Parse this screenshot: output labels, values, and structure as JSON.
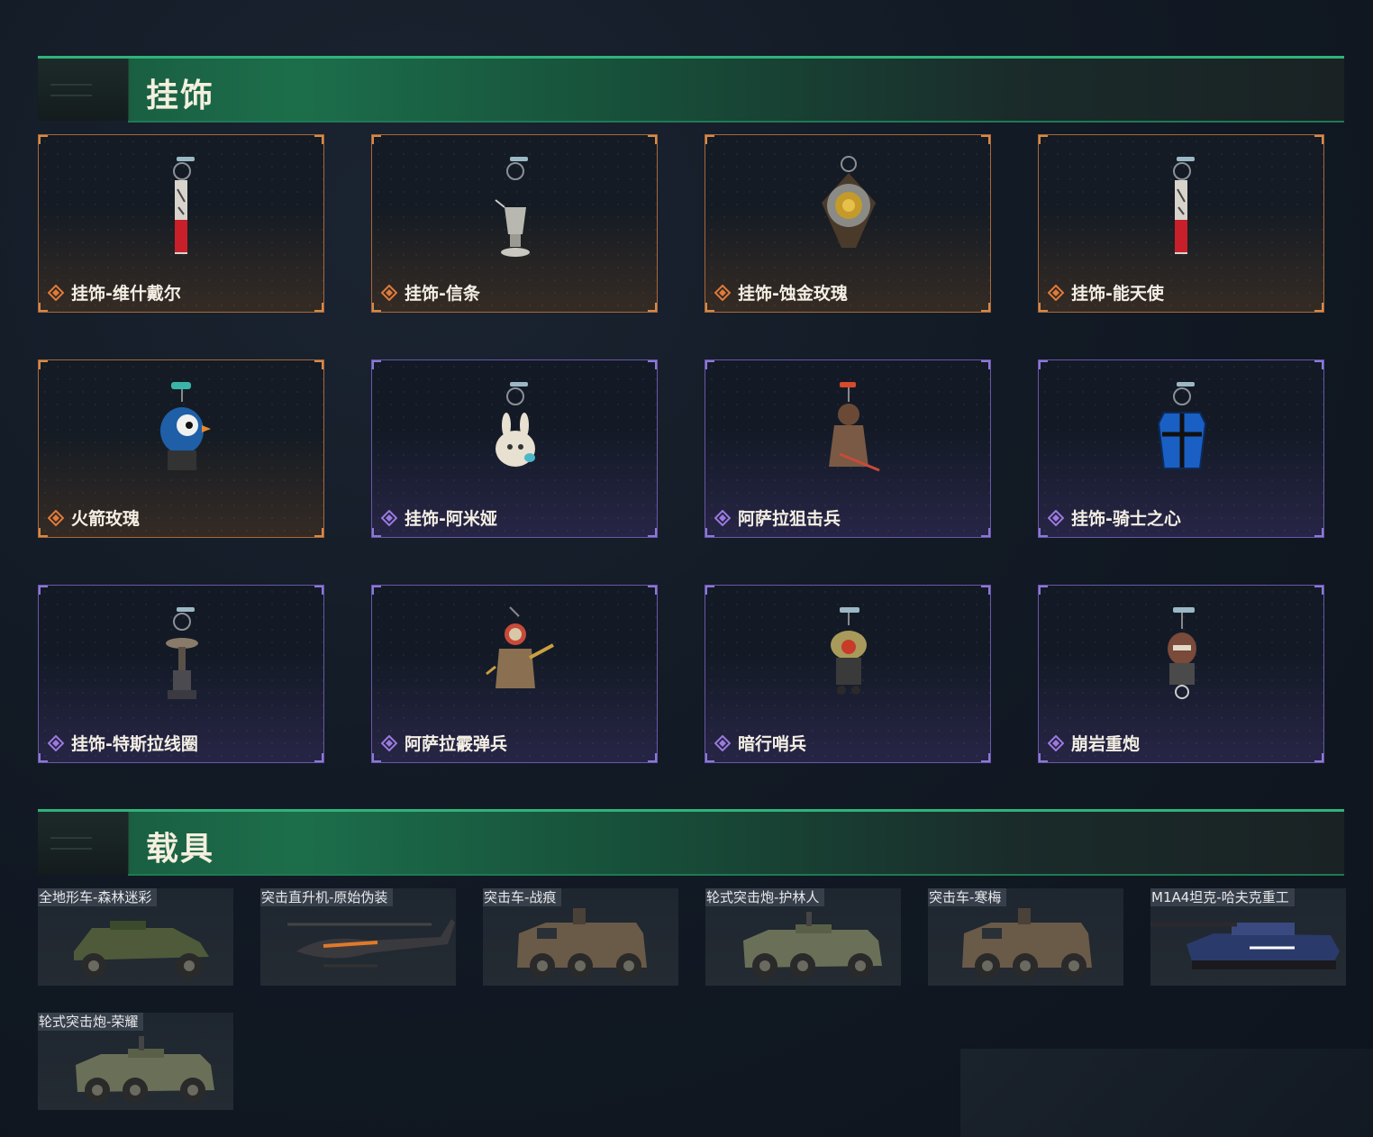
{
  "sections": {
    "charms": {
      "title": "挂饰"
    },
    "vehicles": {
      "title": "载具"
    }
  },
  "charms": [
    {
      "name": "挂饰-维什戴尔",
      "rarity": "gold",
      "icon": "charm-tag-red"
    },
    {
      "name": "挂饰-信条",
      "rarity": "gold",
      "icon": "charm-lantern"
    },
    {
      "name": "挂饰-蚀金玫瑰",
      "rarity": "gold",
      "icon": "charm-rose-medal"
    },
    {
      "name": "挂饰-能天使",
      "rarity": "gold",
      "icon": "charm-tag-red"
    },
    {
      "name": "火箭玫瑰",
      "rarity": "gold",
      "icon": "charm-rocket-figure"
    },
    {
      "name": "挂饰-阿米娅",
      "rarity": "purple",
      "icon": "charm-bunny"
    },
    {
      "name": "阿萨拉狙击兵",
      "rarity": "purple",
      "icon": "charm-sniper-figure"
    },
    {
      "name": "挂饰-骑士之心",
      "rarity": "purple",
      "icon": "charm-blue-shield"
    },
    {
      "name": "挂饰-特斯拉线圈",
      "rarity": "purple",
      "icon": "charm-tesla-coil"
    },
    {
      "name": "阿萨拉霰弹兵",
      "rarity": "purple",
      "icon": "charm-knight-figure"
    },
    {
      "name": "暗行哨兵",
      "rarity": "purple",
      "icon": "charm-sentry-figure"
    },
    {
      "name": "崩岩重炮",
      "rarity": "purple",
      "icon": "charm-cannon-figure"
    }
  ],
  "rarity_colors": {
    "gold": "#e07a3a",
    "purple": "#9a7ae0"
  },
  "vehicles": [
    {
      "name": "全地形车-森林迷彩",
      "icon": "atv-icon"
    },
    {
      "name": "突击直升机-原始伪装",
      "icon": "helicopter-icon"
    },
    {
      "name": "突击车-战痕",
      "icon": "armored-car-icon"
    },
    {
      "name": "轮式突击炮-护林人",
      "icon": "wheeled-assault-gun-icon"
    },
    {
      "name": "突击车-寒梅",
      "icon": "armored-car-icon"
    },
    {
      "name": "M1A4坦克-哈夫克重工",
      "icon": "tank-icon"
    },
    {
      "name": "轮式突击炮-荣耀",
      "icon": "wheeled-assault-gun-icon"
    }
  ]
}
